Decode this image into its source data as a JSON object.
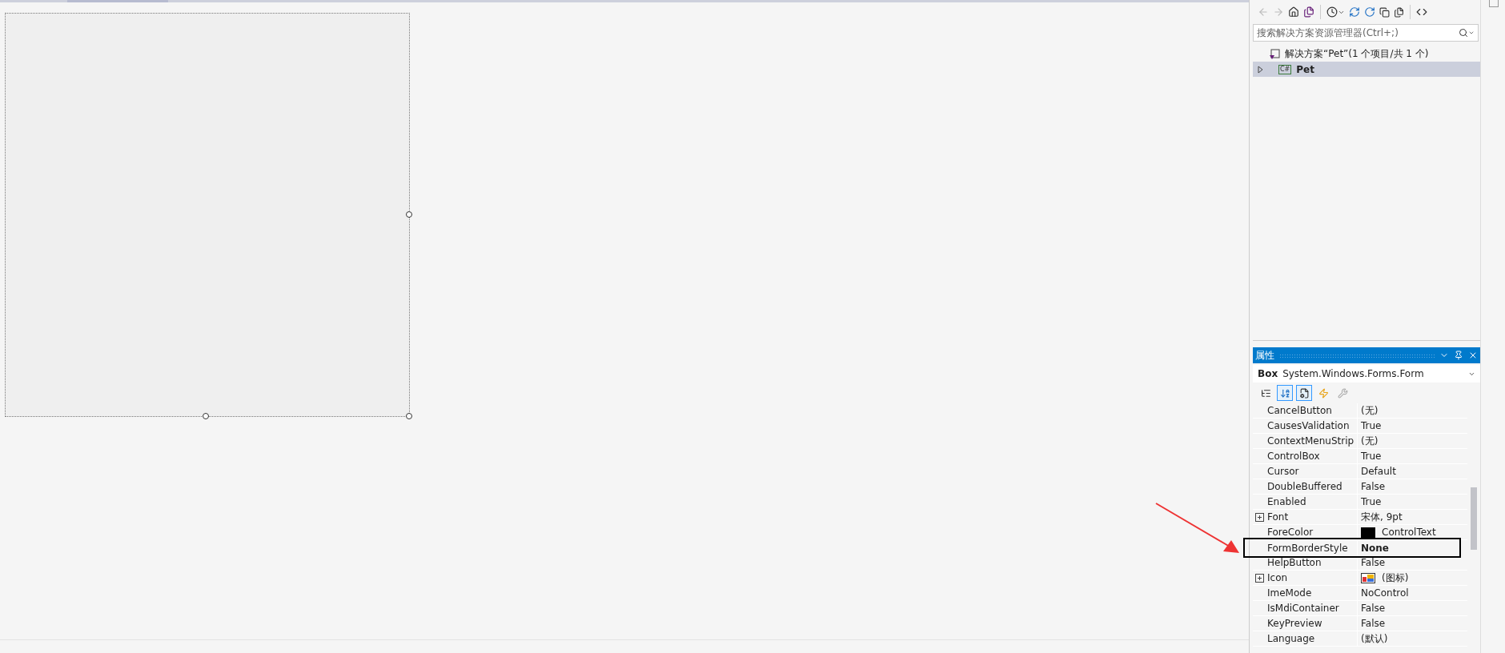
{
  "solution_explorer": {
    "search": {
      "placeholder": "搜索解决方案资源管理器(Ctrl+;)"
    },
    "tree": [
      {
        "label": "解决方案“Pet”(1 个项目/共 1 个)",
        "selected": false,
        "children": [
          {
            "label": "Pet",
            "icon_text": "C#",
            "selected": true,
            "expanded": false
          }
        ]
      }
    ]
  },
  "properties": {
    "title": "属性",
    "object_name": "Box",
    "object_type": "System.Windows.Forms.Form",
    "view_buttons": [
      {
        "selected": false
      },
      {
        "selected": true
      },
      {
        "selected": true
      },
      {
        "selected": false
      },
      {
        "selected": false
      }
    ],
    "rows": [
      {
        "name": "CancelButton",
        "value": "(无)",
        "kind": "text",
        "expandable": false,
        "modified": false,
        "highlighted": false
      },
      {
        "name": "CausesValidation",
        "value": "True",
        "kind": "text",
        "expandable": false,
        "modified": false,
        "highlighted": false
      },
      {
        "name": "ContextMenuStrip",
        "value": "(无)",
        "kind": "text",
        "expandable": false,
        "modified": false,
        "highlighted": false
      },
      {
        "name": "ControlBox",
        "value": "True",
        "kind": "text",
        "expandable": false,
        "modified": false,
        "highlighted": false
      },
      {
        "name": "Cursor",
        "value": "Default",
        "kind": "text",
        "expandable": false,
        "modified": false,
        "highlighted": false
      },
      {
        "name": "DoubleBuffered",
        "value": "False",
        "kind": "text",
        "expandable": false,
        "modified": false,
        "highlighted": false
      },
      {
        "name": "Enabled",
        "value": "True",
        "kind": "text",
        "expandable": false,
        "modified": false,
        "highlighted": false
      },
      {
        "name": "Font",
        "value": "宋体, 9pt",
        "kind": "text",
        "expandable": true,
        "modified": false,
        "highlighted": false
      },
      {
        "name": "ForeColor",
        "value": "ControlText",
        "kind": "color",
        "color": "#000000",
        "expandable": false,
        "modified": false,
        "highlighted": false
      },
      {
        "name": "FormBorderStyle",
        "value": "None",
        "kind": "text",
        "expandable": false,
        "modified": true,
        "highlighted": true
      },
      {
        "name": "HelpButton",
        "value": "False",
        "kind": "text",
        "expandable": false,
        "modified": false,
        "highlighted": false
      },
      {
        "name": "Icon",
        "value": "(图标)",
        "kind": "icon",
        "expandable": true,
        "modified": false,
        "highlighted": false
      },
      {
        "name": "ImeMode",
        "value": "NoControl",
        "kind": "text",
        "expandable": false,
        "modified": false,
        "highlighted": false
      },
      {
        "name": "IsMdiContainer",
        "value": "False",
        "kind": "text",
        "expandable": false,
        "modified": false,
        "highlighted": false
      },
      {
        "name": "KeyPreview",
        "value": "False",
        "kind": "text",
        "expandable": false,
        "modified": false,
        "highlighted": false
      },
      {
        "name": "Language",
        "value": "(默认)",
        "kind": "text",
        "expandable": false,
        "modified": false,
        "highlighted": false
      }
    ]
  }
}
